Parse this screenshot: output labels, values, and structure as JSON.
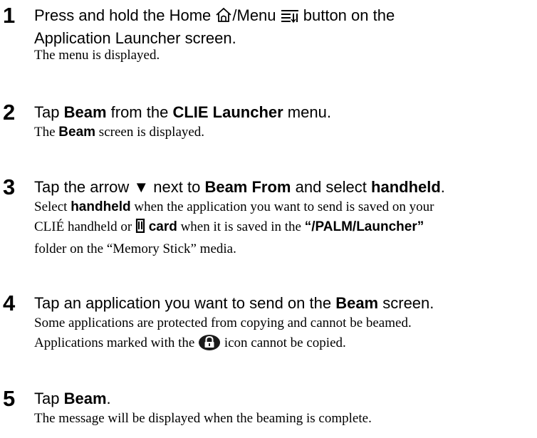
{
  "steps": [
    {
      "number": "1",
      "instruction": {
        "pre": "Press and hold the Home ",
        "mid": "/Menu ",
        "line1_end": " button on the",
        "line2": "Application Launcher screen."
      },
      "detail": "The menu is displayed.",
      "icons": [
        "home-icon",
        "menu-icon"
      ]
    },
    {
      "number": "2",
      "instruction": {
        "pre": "Tap ",
        "b1": "Beam",
        "mid": " from the ",
        "b2": "CLIE Launcher",
        "post": " menu."
      },
      "detail": {
        "pre": "The ",
        "b": "Beam",
        "post": " screen is displayed."
      }
    },
    {
      "number": "3",
      "instruction": {
        "pre": "Tap the arrow ▼ next to ",
        "b1": "Beam From",
        "mid": " and select ",
        "b2": "handheld",
        "post": "."
      },
      "detail": {
        "l1_pre": "Select ",
        "l1_b": "handheld",
        "l1_post": " when the application you want to send is saved on your",
        "l2_pre": "CLIÉ handheld or ",
        "l2_b1": "card",
        "l2_mid": " when it is saved in the ",
        "l2_b2": "“/PALM/Launcher”",
        "l3": "folder on the “Memory Stick” media."
      },
      "icons": [
        "memory-card-icon"
      ]
    },
    {
      "number": "4",
      "instruction": {
        "pre": "Tap an application you want to send on the ",
        "b": "Beam",
        "post": " screen."
      },
      "detail": {
        "l1": "Some applications are protected from copying and cannot be beamed.",
        "l2_pre": "Applications marked with the ",
        "l2_post": " icon cannot be copied."
      },
      "icons": [
        "lock-icon"
      ]
    },
    {
      "number": "5",
      "instruction": {
        "pre": "Tap ",
        "b": "Beam",
        "post": "."
      },
      "detail": "The message will be displayed when the beaming is complete."
    }
  ]
}
